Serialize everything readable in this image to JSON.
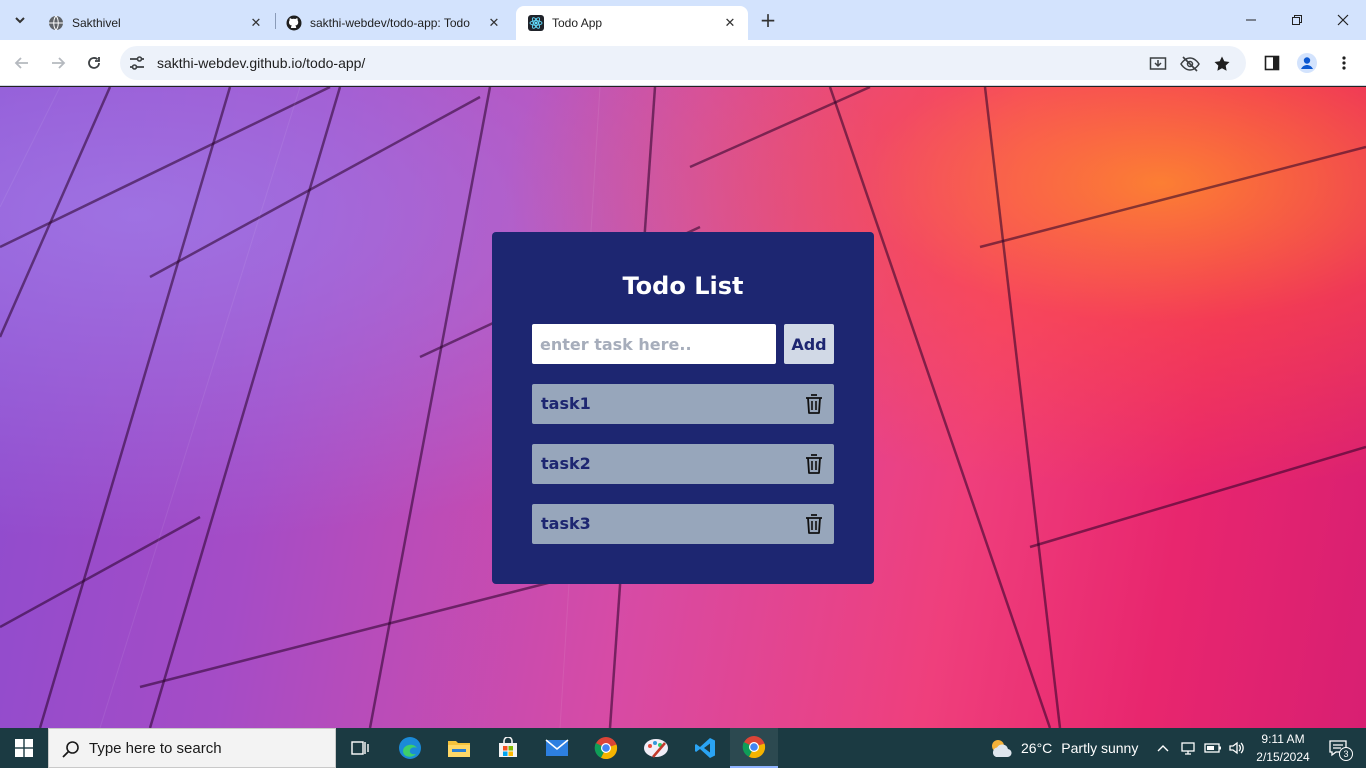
{
  "browser": {
    "tabs": [
      {
        "title": "Sakthivel",
        "favicon": "globe-icon"
      },
      {
        "title": "sakthi-webdev/todo-app: Todo",
        "favicon": "github-icon"
      },
      {
        "title": "Todo App",
        "favicon": "react-icon"
      }
    ],
    "active_tab": 2,
    "url": "sakthi-webdev.github.io/todo-app/"
  },
  "app": {
    "title": "Todo List",
    "input_placeholder": "enter task here..",
    "add_label": "Add",
    "tasks": [
      {
        "label": "task1"
      },
      {
        "label": "task2"
      },
      {
        "label": "task3"
      }
    ],
    "colors": {
      "card": "#1d2671",
      "task_bg": "#97a6bb",
      "add_bg": "#d1d9e6"
    }
  },
  "taskbar": {
    "search_placeholder": "Type here to search",
    "weather_temp": "26°C",
    "weather_text": "Partly sunny",
    "time": "9:11 AM",
    "date": "2/15/2024",
    "notification_count": "3"
  }
}
